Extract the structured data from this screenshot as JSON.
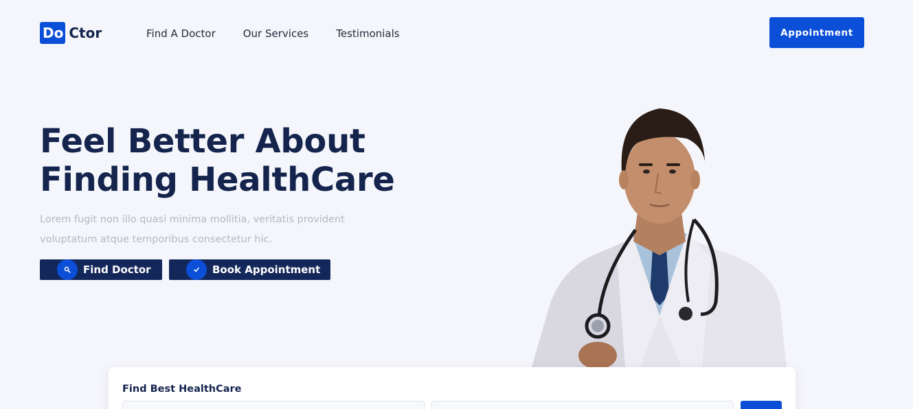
{
  "brand": {
    "logo_box": "Do",
    "logo_text": "Ctor"
  },
  "nav": {
    "items": [
      {
        "label": "Find A Doctor"
      },
      {
        "label": "Our Services"
      },
      {
        "label": "Testimonials"
      }
    ]
  },
  "header": {
    "appointment_label": "Appointment"
  },
  "hero": {
    "title_line1": "Feel Better About",
    "title_line2": "Finding HealthCare",
    "description": "Lorem fugit non illo quasi minima mollitia, veritatis provident voluptatum atque temporibus consectetur hic.",
    "find_doctor_label": "Find Doctor",
    "book_appointment_label": "Book Appointment"
  },
  "search": {
    "title": "Find Best HealthCare",
    "field1_placeholder": "",
    "field2_placeholder": ""
  },
  "colors": {
    "primary": "#0b4fd8",
    "navy": "#13275a",
    "heading": "#14244d",
    "background": "#f5f6fb",
    "muted_text": "#b4b8c4"
  },
  "icons": {
    "find_doctor": "search-icon",
    "book_appointment": "check-icon",
    "search_button": "search-icon"
  }
}
